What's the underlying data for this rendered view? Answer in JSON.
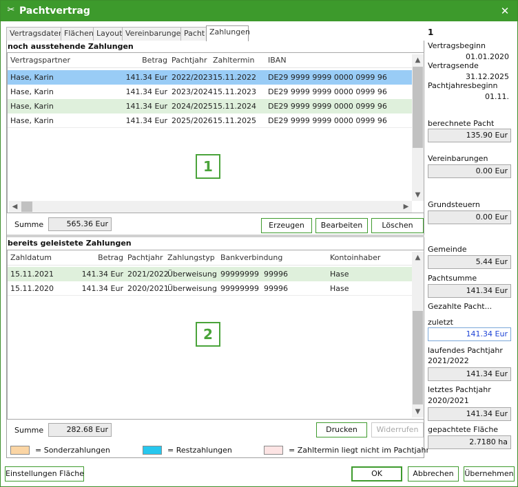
{
  "window": {
    "title": "Pachtvertrag",
    "close_glyph": "✕",
    "icon_glyph": "✂"
  },
  "tabs": [
    "Vertragsdaten",
    "Flächen",
    "Layout",
    "Vereinbarungen",
    "Pacht",
    "Zahlungen"
  ],
  "active_tab": "Zahlungen",
  "pending": {
    "title": "noch ausstehende Zahlungen",
    "columns": [
      "Vertragspartner",
      "Betrag",
      "Pachtjahr",
      "Zahltermin",
      "IBAN"
    ],
    "rows": [
      [
        "Hase, Karin",
        "141.34 Eur",
        "2022/2023",
        "15.11.2022",
        "DE29 9999 9999 0000 0999 96"
      ],
      [
        "Hase, Karin",
        "141.34 Eur",
        "2023/2024",
        "15.11.2023",
        "DE29 9999 9999 0000 0999 96"
      ],
      [
        "Hase, Karin",
        "141.34 Eur",
        "2024/2025",
        "15.11.2024",
        "DE29 9999 9999 0000 0999 96"
      ],
      [
        "Hase, Karin",
        "141.34 Eur",
        "2025/2026",
        "15.11.2025",
        "DE29 9999 9999 0000 0999 96"
      ]
    ],
    "badge": "1",
    "sum_label": "Summe",
    "sum_value": "565.36 Eur",
    "buttons": {
      "create": "Erzeugen",
      "edit": "Bearbeiten",
      "delete": "Löschen"
    }
  },
  "paid": {
    "title": "bereits geleistete Zahlungen",
    "columns": [
      "Zahldatum",
      "Betrag",
      "Pachtjahr",
      "Zahlungstyp",
      "Bankverbindung",
      "Kontoinhaber"
    ],
    "rows": [
      [
        "15.11.2021",
        "141.34 Eur",
        "2021/2022",
        "Überweisung",
        "99999999  99996",
        "Hase"
      ],
      [
        "15.11.2020",
        "141.34 Eur",
        "2020/2021",
        "Überweisung",
        "99999999  99996",
        "Hase"
      ]
    ],
    "badge": "2",
    "sum_label": "Summe",
    "sum_value": "282.68 Eur",
    "buttons": {
      "print": "Drucken",
      "revoke": "Widerrufen"
    }
  },
  "legend": [
    {
      "label": "= Sonderzahlungen",
      "color": "#fbd5a4"
    },
    {
      "label": "= Restzahlungen",
      "color": "#27c7ee"
    },
    {
      "label": "= Zahltermin liegt nicht im Pachtjahr",
      "color": "#fde4e4"
    }
  ],
  "side": {
    "number": "1",
    "contract_start_label": "Vertragsbeginn",
    "contract_start": "01.01.2020",
    "contract_end_label": "Vertragsende",
    "contract_end": "31.12.2025",
    "lease_year_start_label": "Pachtjahresbeginn",
    "lease_year_start": "01.11.",
    "calc_lease_label": "berechnete Pacht",
    "calc_lease": "135.90 Eur",
    "agreements_label": "Vereinbarungen",
    "agreements": "0.00 Eur",
    "property_tax_label": "Grundsteuern",
    "property_tax": "0.00 Eur",
    "municipality_label": "Gemeinde",
    "municipality": "5.44 Eur",
    "lease_sum_label": "Pachtsumme",
    "lease_sum": "141.34 Eur",
    "paid_lease_label": "Gezahlte Pacht...",
    "last_label": "zuletzt",
    "last": "141.34 Eur",
    "current_year_label": "laufendes Pachtjahr",
    "current_year": "2021/2022",
    "current_year_value": "141.34 Eur",
    "prev_year_label": "letztes Pachtjahr",
    "prev_year": "2020/2021",
    "prev_year_value": "141.34 Eur",
    "area_label": "gepachtete Fläche",
    "area": "2.7180 ha"
  },
  "footer": {
    "settings": "Einstellungen Fläche",
    "ok": "OK",
    "cancel": "Abbrechen",
    "apply": "Übernehmen"
  },
  "scroll_glyphs": {
    "up": "▲",
    "down": "▼",
    "left": "◀",
    "right": "▶"
  }
}
